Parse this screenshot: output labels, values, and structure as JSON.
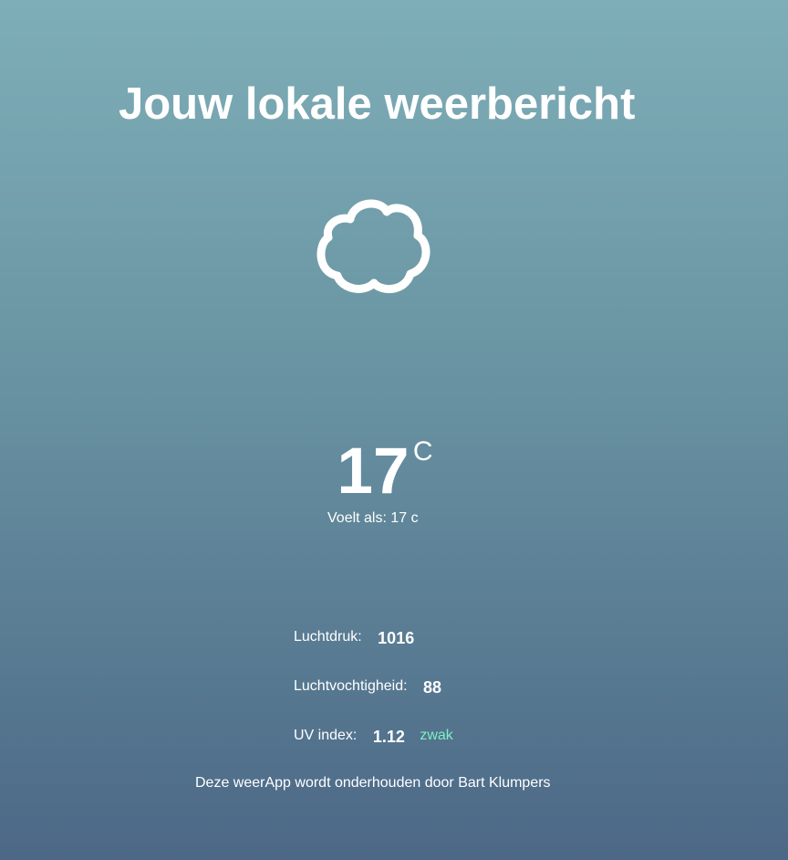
{
  "header": {
    "title": "Jouw lokale weerbericht"
  },
  "weather": {
    "icon": "cloud-icon",
    "temperature": "17",
    "unit": "C",
    "feels_like": "Voelt als: 17 c"
  },
  "stats": {
    "pressure": {
      "label": "Luchtdruk:",
      "value": "1016"
    },
    "humidity": {
      "label": "Luchtvochtigheid:",
      "value": "88"
    },
    "uv": {
      "label": "UV index:",
      "value": "1.12",
      "rating": "zwak"
    }
  },
  "footer": {
    "text": "Deze weerApp wordt onderhouden door Bart Klumpers"
  },
  "colors": {
    "background_top": "#7eaeb8",
    "background_bottom": "#4c6886",
    "text": "#ffffff",
    "uv_rating": "#7ff0c6"
  }
}
